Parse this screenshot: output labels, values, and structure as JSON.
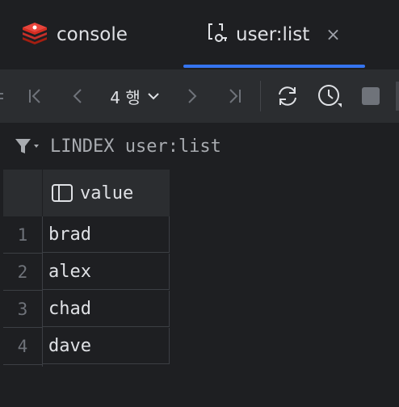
{
  "tabs": [
    {
      "label": "console",
      "icon": "redis-logo-icon"
    },
    {
      "label": "user:list",
      "icon": "list-key-icon",
      "close": "×"
    }
  ],
  "colors": {
    "accent": "#3574f0",
    "background": "#1e1f22",
    "toolbar": "#2b2d30",
    "redis": "#d82c20"
  },
  "toolbar": {
    "rows_label": "4 행",
    "icons": [
      "first-page-icon",
      "previous-page-icon",
      "chevron-down-icon",
      "next-page-icon",
      "last-page-icon",
      "refresh-icon",
      "history-icon",
      "stop-icon"
    ]
  },
  "filter": {
    "text": "LINDEX user:list",
    "icon": "filter-icon"
  },
  "table": {
    "column": "value",
    "rows": [
      {
        "num": "1",
        "value": "brad"
      },
      {
        "num": "2",
        "value": "alex"
      },
      {
        "num": "3",
        "value": "chad"
      },
      {
        "num": "4",
        "value": "dave"
      }
    ]
  }
}
